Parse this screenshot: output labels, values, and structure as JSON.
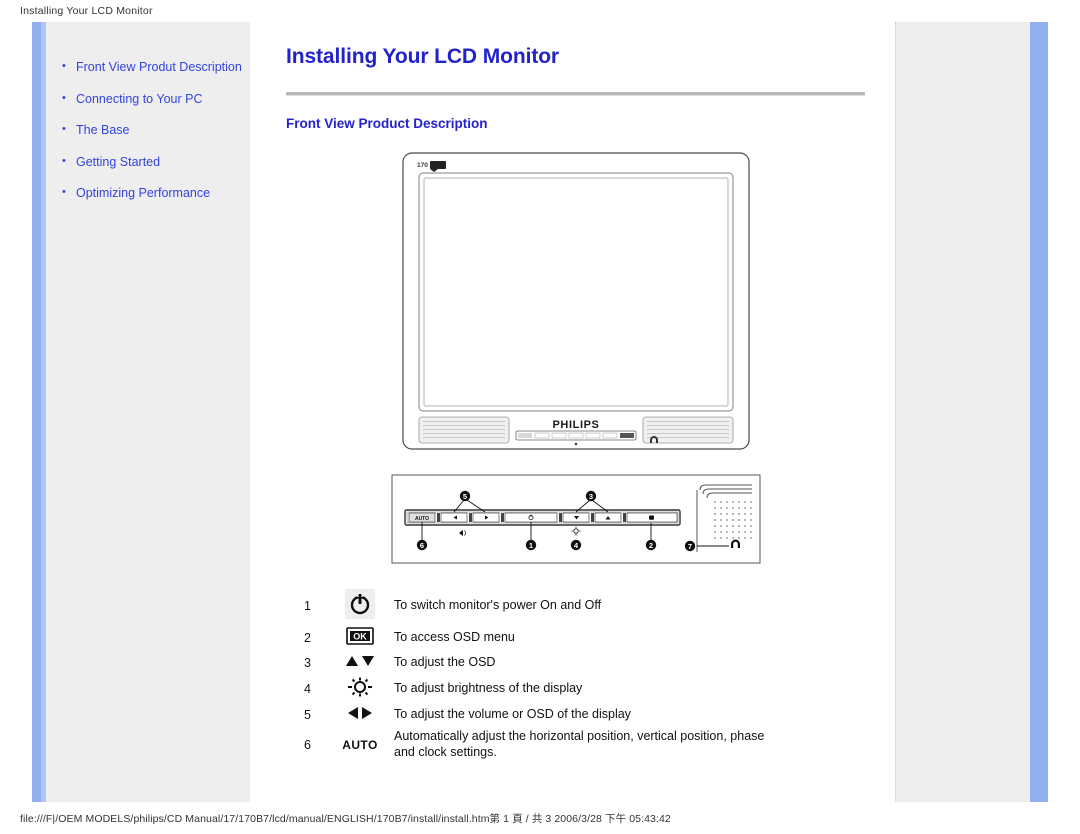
{
  "print": {
    "header": "Installing Your LCD Monitor",
    "footer": "file:///F|/OEM MODELS/philips/CD Manual/17/170B7/lcd/manual/ENGLISH/170B7/install/install.htm第 1 頁 / 共 3 2006/3/28 下午 05:43:42"
  },
  "colors": {
    "link": "#3344dd",
    "heading": "#2222cc",
    "rail": "#92b0f0",
    "sidebar_bg": "#eeeeee"
  },
  "sidebar": {
    "items": [
      {
        "label": "Front View Produt Description"
      },
      {
        "label": "Connecting to Your PC"
      },
      {
        "label": "The Base"
      },
      {
        "label": "Getting Started"
      },
      {
        "label": "Optimizing Performance"
      }
    ]
  },
  "main": {
    "title": "Installing Your LCD Monitor",
    "section_title": "Front View Product Description",
    "monitor_figure": {
      "model_badge": "170B7",
      "brand": "PHILIPS",
      "headphone_label": "headphone-jack"
    },
    "callout_figure": {
      "callouts": [
        "1",
        "2",
        "3",
        "4",
        "5",
        "6",
        "7"
      ],
      "auto_button_label": "AUTO"
    },
    "legend": {
      "rows": [
        {
          "num": "1",
          "icon": "power-icon",
          "desc": "To switch monitor's power On and Off"
        },
        {
          "num": "2",
          "icon": "ok-icon",
          "desc": "To access OSD menu"
        },
        {
          "num": "3",
          "icon": "up-down-icon",
          "desc": "To adjust the OSD"
        },
        {
          "num": "4",
          "icon": "brightness-icon",
          "desc": "To adjust brightness of the display"
        },
        {
          "num": "5",
          "icon": "left-right-icon",
          "desc": "To adjust the volume or OSD of the display"
        },
        {
          "num": "6",
          "icon": "auto-text-icon",
          "desc": "Automatically adjust the horizontal position, vertical position, phase and clock settings.",
          "icon_text": "AUTO"
        }
      ]
    }
  }
}
